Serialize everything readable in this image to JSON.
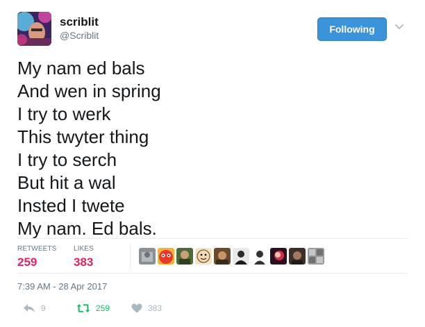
{
  "user": {
    "display_name": "scriblit",
    "handle": "@Scriblit"
  },
  "follow_button": {
    "label": "Following",
    "color": "#3b94d9"
  },
  "tweet": {
    "lines": [
      "My nam ed bals",
      "And wen in spring",
      "I try to werk",
      "This twyter thing",
      "I try to serch",
      "But hit a wal",
      "Insted I twete",
      "My nam. Ed bals."
    ]
  },
  "stats": {
    "retweets_label": "RETWEETS",
    "retweets_count": "259",
    "likes_label": "LIKES",
    "likes_count": "383",
    "count_color": "#e0245e"
  },
  "likers": [
    {
      "icon": "avatar-grey-photo"
    },
    {
      "icon": "avatar-red-cartoon"
    },
    {
      "icon": "avatar-green-photo"
    },
    {
      "icon": "avatar-cartoon-face"
    },
    {
      "icon": "avatar-brown-photo"
    },
    {
      "icon": "avatar-dark-suit"
    },
    {
      "icon": "avatar-silhouette"
    },
    {
      "icon": "avatar-red-portrait"
    },
    {
      "icon": "avatar-dark-portrait"
    },
    {
      "icon": "avatar-grey-pattern"
    }
  ],
  "timestamp": "7:39 AM - 28 Apr 2017",
  "actions": {
    "reply_count": "9",
    "retweet_count": "259",
    "like_count": "383",
    "retweet_color": "#17bf63",
    "muted_color": "#aab8c2"
  }
}
